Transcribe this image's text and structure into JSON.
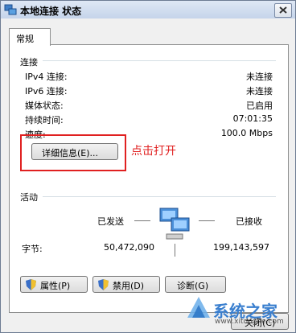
{
  "window": {
    "title": "本地连接 状态"
  },
  "tabs": [
    {
      "label": "常规"
    }
  ],
  "connection": {
    "section_title": "连接",
    "rows": [
      {
        "label": "IPv4 连接:",
        "value": "未连接"
      },
      {
        "label": "IPv6 连接:",
        "value": "未连接"
      },
      {
        "label": "媒体状态:",
        "value": "已启用"
      },
      {
        "label": "持续时间:",
        "value": "07:01:35"
      },
      {
        "label": "速度:",
        "value": "100.0 Mbps"
      }
    ],
    "details_button": "详细信息(E)...",
    "annotation": "点击打开"
  },
  "activity": {
    "section_title": "活动",
    "sent_label": "已发送",
    "received_label": "已接收",
    "bytes_label": "字节:",
    "bytes_sent": "50,472,090",
    "bytes_received": "199,143,597"
  },
  "buttons": {
    "properties": "属性(P)",
    "disable": "禁用(D)",
    "diagnose": "诊断(G)",
    "close": "关闭(C)"
  },
  "watermark": {
    "text": "系统之家",
    "url": "www.xitonghe.com"
  },
  "colors": {
    "annotation": "#e02020",
    "accent": "#3a7fcf"
  }
}
